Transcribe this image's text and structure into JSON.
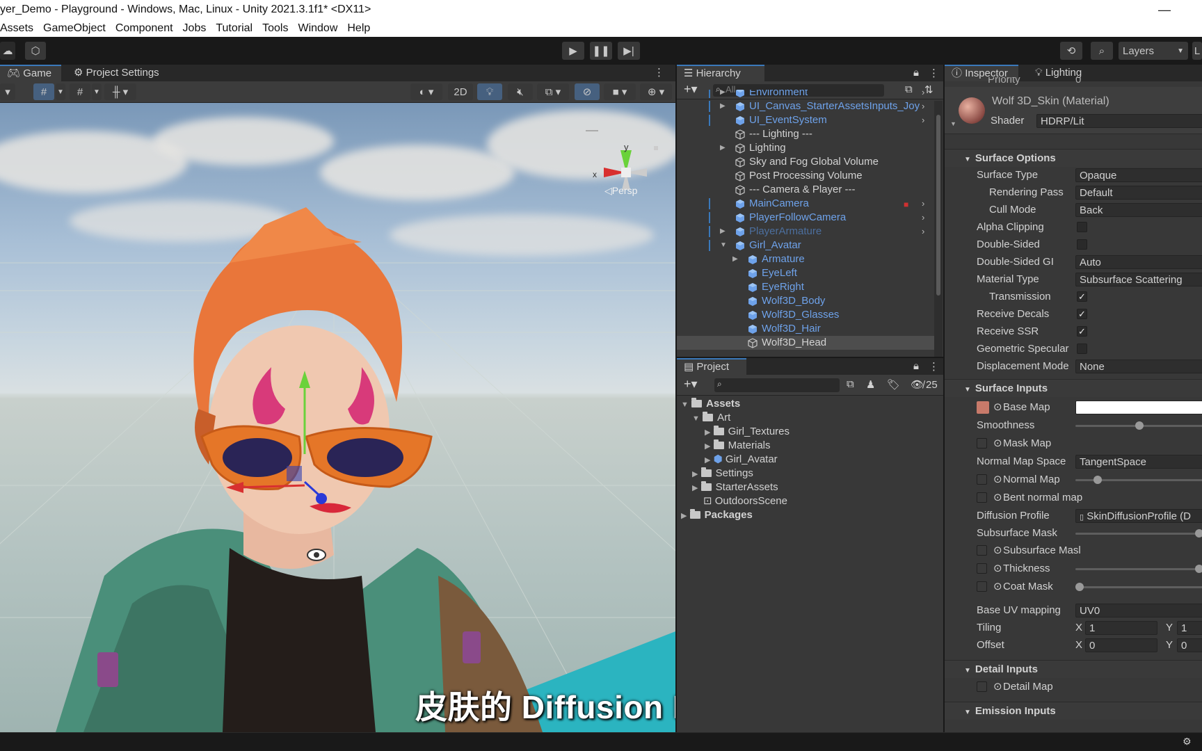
{
  "window": {
    "title": "yer_Demo - Playground - Windows, Mac, Linux - Unity 2021.3.1f1* <DX11>"
  },
  "menu": [
    "Assets",
    "GameObject",
    "Component",
    "Jobs",
    "Tutorial",
    "Tools",
    "Window",
    "Help"
  ],
  "toolbar": {
    "layers_label": "Layers",
    "layout_label": "L"
  },
  "scene": {
    "tabs": [
      "Game",
      "Project Settings"
    ],
    "toggle_2d": "2D",
    "gizmo": {
      "y": "y",
      "x": "x",
      "persp": "Persp"
    },
    "subtitle": "皮肤的 Diffusion Profile"
  },
  "hierarchy": {
    "tab": "Hierarchy",
    "search_placeholder": "All",
    "items": [
      {
        "name": "Environment",
        "blue": true
      },
      {
        "name": "UI_Canvas_StarterAssetsInputs_Joy",
        "blue": true
      },
      {
        "name": "UI_EventSystem",
        "blue": true
      },
      {
        "name": "--- Lighting ---",
        "blue": false
      },
      {
        "name": "Lighting",
        "blue": false
      },
      {
        "name": "Sky and Fog Global Volume",
        "blue": false
      },
      {
        "name": "Post Processing Volume",
        "blue": false
      },
      {
        "name": "--- Camera & Player ---",
        "blue": false
      },
      {
        "name": "MainCamera",
        "blue": true
      },
      {
        "name": "PlayerFollowCamera",
        "blue": true
      },
      {
        "name": "PlayerArmature",
        "blue": true
      },
      {
        "name": "Girl_Avatar",
        "blue": true
      },
      {
        "name": "Armature",
        "blue": true
      },
      {
        "name": "EyeLeft",
        "blue": true
      },
      {
        "name": "EyeRight",
        "blue": true
      },
      {
        "name": "Wolf3D_Body",
        "blue": true
      },
      {
        "name": "Wolf3D_Glasses",
        "blue": true
      },
      {
        "name": "Wolf3D_Hair",
        "blue": true
      },
      {
        "name": "Wolf3D_Head",
        "blue": false
      }
    ]
  },
  "project": {
    "tab": "Project",
    "hidden_count": "25",
    "items": [
      "Assets",
      "Art",
      "Girl_Textures",
      "Materials",
      "Girl_Avatar",
      "Settings",
      "StarterAssets",
      "OutdoorsScene",
      "Packages"
    ]
  },
  "inspector": {
    "tabs": [
      "Inspector",
      "Lighting"
    ],
    "cut_label": "Priority",
    "cut_value": "0",
    "material_name": "Wolf 3D_Skin (Material)",
    "shader_label": "Shader",
    "shader_value": "HDRP/Lit",
    "sections": {
      "surface_options": "Surface Options",
      "surface_inputs": "Surface Inputs",
      "detail_inputs": "Detail Inputs",
      "emission_inputs": "Emission Inputs"
    },
    "options": {
      "surface_type": {
        "label": "Surface Type",
        "value": "Opaque"
      },
      "rendering_pass": {
        "label": "Rendering Pass",
        "value": "Default"
      },
      "cull_mode": {
        "label": "Cull Mode",
        "value": "Back"
      },
      "alpha_clipping": {
        "label": "Alpha Clipping",
        "checked": false
      },
      "double_sided": {
        "label": "Double-Sided",
        "checked": false
      },
      "double_sided_gi": {
        "label": "Double-Sided GI",
        "value": "Auto"
      },
      "material_type": {
        "label": "Material Type",
        "value": "Subsurface Scattering"
      },
      "transmission": {
        "label": "Transmission",
        "checked": true
      },
      "receive_decals": {
        "label": "Receive Decals",
        "checked": true
      },
      "receive_ssr": {
        "label": "Receive SSR",
        "checked": true
      },
      "geometric_specular": {
        "label": "Geometric Specular",
        "checked": false
      },
      "displacement_mode": {
        "label": "Displacement Mode",
        "value": "None"
      }
    },
    "inputs": {
      "base_map": "Base Map",
      "smoothness": {
        "label": "Smoothness",
        "level": 0.5
      },
      "mask_map": "Mask Map",
      "normal_map_space": {
        "label": "Normal Map Space",
        "value": "TangentSpace"
      },
      "normal_map": {
        "label": "Normal Map",
        "level": 0.15
      },
      "bent_normal_map": "Bent normal map",
      "diffusion_profile": {
        "label": "Diffusion Profile",
        "value": "SkinDiffusionProfile (D"
      },
      "subsurface_mask": {
        "label": "Subsurface Mask",
        "level": 1.0
      },
      "subsurface_mask_map": "Subsurface Masl",
      "thickness": {
        "label": "Thickness",
        "level": 1.0
      },
      "coat_mask": {
        "label": "Coat Mask",
        "level": 0.0
      },
      "base_uv_mapping": {
        "label": "Base UV mapping",
        "value": "UV0"
      },
      "tiling": {
        "label": "Tiling",
        "x": "1",
        "y": "1"
      },
      "offset": {
        "label": "Offset",
        "x": "0",
        "y": "0"
      },
      "detail_map": "Detail Map",
      "axis_x": "X",
      "axis_y": "Y"
    }
  },
  "colors": {
    "accent": "#3a79bb",
    "prefab_blue": "#6ea2ea",
    "panel": "#383838",
    "dark": "#191919"
  }
}
